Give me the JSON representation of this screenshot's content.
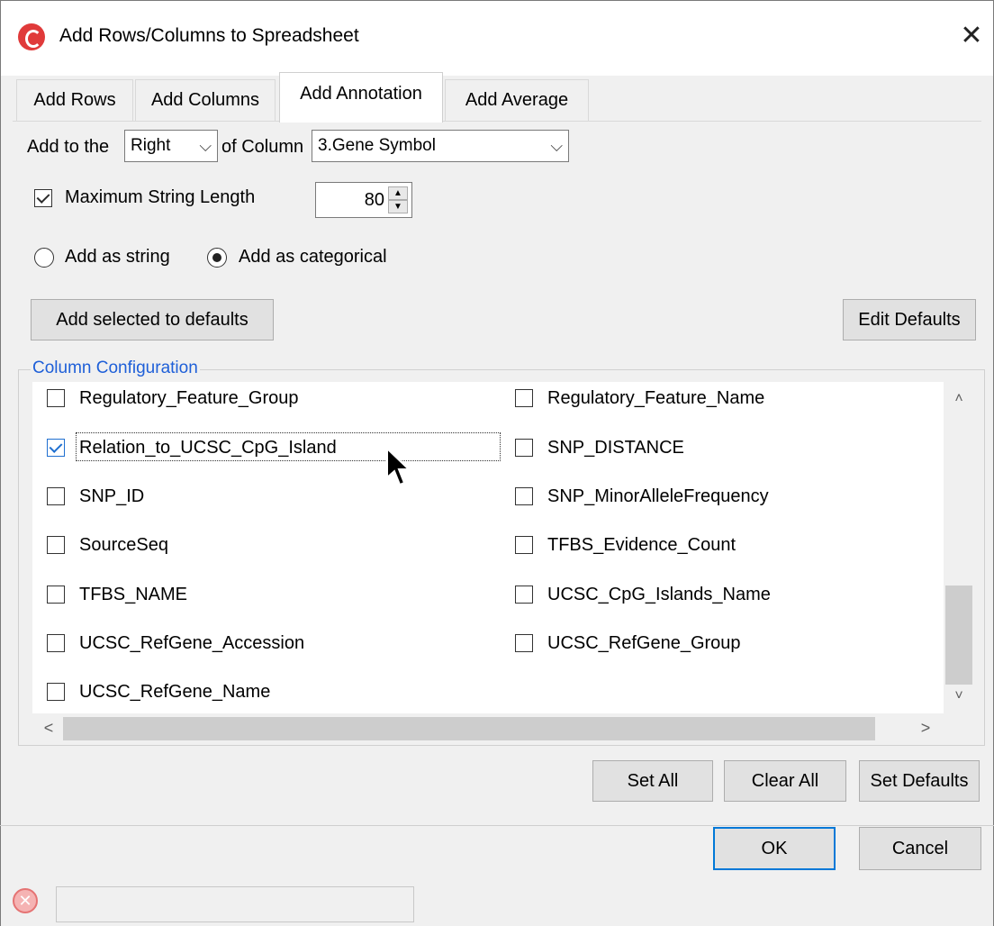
{
  "window": {
    "title": "Add Rows/Columns to Spreadsheet",
    "close_glyph": "✕"
  },
  "tabs": [
    {
      "label": "Add Rows"
    },
    {
      "label": "Add Columns"
    },
    {
      "label": "Add Annotation"
    },
    {
      "label": "Add Average"
    }
  ],
  "position_row": {
    "prefix": "Add to the",
    "side_value": "Right",
    "middle": "of Column",
    "column_value": "3.Gene Symbol",
    "chevron": "⌵"
  },
  "max_length": {
    "label": "Maximum String Length",
    "checked": true,
    "value": "80"
  },
  "add_as": {
    "string_label": "Add as string",
    "categorical_label": "Add as categorical",
    "selected": "categorical"
  },
  "buttons": {
    "add_selected_defaults": "Add selected to defaults",
    "edit_defaults": "Edit Defaults",
    "set_all": "Set All",
    "clear_all": "Clear All",
    "set_defaults": "Set Defaults",
    "ok": "OK",
    "cancel": "Cancel"
  },
  "column_config": {
    "title": "Column Configuration",
    "left": [
      {
        "label": "Regulatory_Feature_Group",
        "checked": false
      },
      {
        "label": "Relation_to_UCSC_CpG_Island",
        "checked": true
      },
      {
        "label": "SNP_ID",
        "checked": false
      },
      {
        "label": "SourceSeq",
        "checked": false
      },
      {
        "label": "TFBS_NAME",
        "checked": false
      },
      {
        "label": "UCSC_RefGene_Accession",
        "checked": false
      },
      {
        "label": "UCSC_RefGene_Name",
        "checked": false
      }
    ],
    "right": [
      {
        "label": "Regulatory_Feature_Name",
        "checked": false
      },
      {
        "label": "SNP_DISTANCE",
        "checked": false
      },
      {
        "label": "SNP_MinorAlleleFrequency",
        "checked": false
      },
      {
        "label": "TFBS_Evidence_Count",
        "checked": false
      },
      {
        "label": "UCSC_CpG_Islands_Name",
        "checked": false
      },
      {
        "label": "UCSC_RefGene_Group",
        "checked": false
      }
    ],
    "scroll_up": "˄",
    "scroll_down": "˅",
    "scroll_left": "<",
    "scroll_right": ">"
  },
  "status": {
    "text": ""
  },
  "colors": {
    "accent": "#0078d7",
    "group_title": "#1e5fd8"
  }
}
